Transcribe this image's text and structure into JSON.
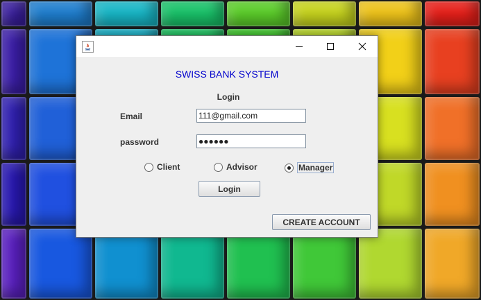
{
  "window": {
    "title": "",
    "controls": {
      "minimize_icon": "minimize-icon",
      "maximize_icon": "maximize-icon",
      "close_icon": "close-icon"
    }
  },
  "form": {
    "app_title": "SWISS BANK SYSTEM",
    "section_title": "Login",
    "email_label": "Email",
    "email_value": "111@gmail.com",
    "password_label": "password",
    "password_mask": "●●●●●●",
    "roles": [
      {
        "label": "Client",
        "selected": false
      },
      {
        "label": "Advisor",
        "selected": false
      },
      {
        "label": "Manager",
        "selected": true
      }
    ],
    "login_button": "Login",
    "create_account_button": "CREATE ACCOUNT"
  },
  "colors": {
    "title_blue": "#0000cc",
    "window_bg": "#efefef"
  }
}
